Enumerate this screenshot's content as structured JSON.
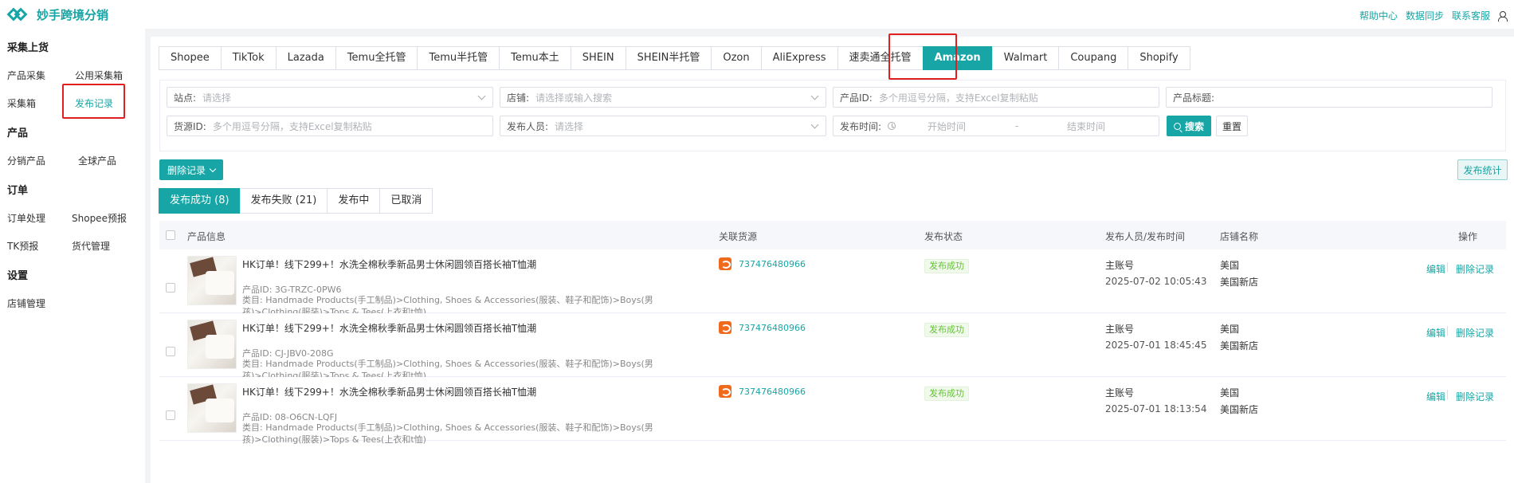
{
  "app": {
    "title": "妙手跨境分销"
  },
  "top_links": [
    "帮助中心",
    "数据同步",
    "联系客服"
  ],
  "sidebar": {
    "group1": "采集上货",
    "item_collect": "产品采集",
    "item_public_box": "公用采集箱",
    "item_collect_box": "采集箱",
    "item_publish_record": "发布记录",
    "group2": "产品",
    "item_dist_product": "分销产品",
    "item_global_product": "全球产品",
    "group3": "订单",
    "item_order_process": "订单处理",
    "item_shopee_forecast": "Shopee预报",
    "item_tk_forecast": "TK预报",
    "item_cargo_manage": "货代管理",
    "group4": "设置",
    "item_store_manage": "店铺管理"
  },
  "platform_tabs": [
    "Shopee",
    "TikTok",
    "Lazada",
    "Temu全托管",
    "Temu半托管",
    "Temu本土",
    "SHEIN",
    "SHEIN半托管",
    "Ozon",
    "AliExpress",
    "速卖通全托管",
    "Amazon",
    "Walmart",
    "Coupang",
    "Shopify"
  ],
  "active_platform": "Amazon",
  "filters": {
    "site_label": "站点:",
    "site_placeholder": "请选择",
    "store_label": "店铺:",
    "store_placeholder": "请选择或输入搜索",
    "product_id_label": "产品ID:",
    "product_id_placeholder": "多个用逗号分隔，支持Excel复制粘贴",
    "product_title_label": "产品标题:",
    "source_id_label": "货源ID:",
    "source_id_placeholder": "多个用逗号分隔，支持Excel复制粘贴",
    "publisher_label": "发布人员:",
    "publisher_placeholder": "请选择",
    "publish_time_label": "发布时间:",
    "start_time_placeholder": "开始时间",
    "time_sep": "-",
    "end_time_placeholder": "结束时间",
    "search_button": "搜索",
    "reset_button": "重置"
  },
  "toolbar": {
    "delete_records": "删除记录",
    "publish_stats": "发布统计"
  },
  "status_tabs": [
    "发布成功 (8)",
    "发布失败 (21)",
    "发布中",
    "已取消"
  ],
  "table": {
    "headers": {
      "product_info": "产品信息",
      "source": "关联货源",
      "status": "发布状态",
      "publisher_time": "发布人员/发布时间",
      "store_name": "店铺名称",
      "actions": "操作"
    },
    "rows": [
      {
        "title": "HK订单！线下299+！水洗全棉秋季新品男士休闲圆领百搭长袖T恤潮",
        "product_id": "产品ID: 3G-TRZC-0PW6",
        "category": "类目: Handmade Products(手工制品)>Clothing, Shoes & Accessories(服装、鞋子和配饰)>Boys(男孩)>Clothing(服装)>Tops & Tees(上衣和t恤)",
        "source_id": "737476480966",
        "status": "发布成功",
        "publisher": "主账号",
        "time": "2025-07-02 10:05:43",
        "region": "美国",
        "store": "美国新店",
        "edit": "编辑",
        "delete": "删除记录"
      },
      {
        "title": "HK订单！线下299+！水洗全棉秋季新品男士休闲圆领百搭长袖T恤潮",
        "product_id": "产品ID: CJ-JBV0-208G",
        "category": "类目: Handmade Products(手工制品)>Clothing, Shoes & Accessories(服装、鞋子和配饰)>Boys(男孩)>Clothing(服装)>Tops & Tees(上衣和t恤)",
        "source_id": "737476480966",
        "status": "发布成功",
        "publisher": "主账号",
        "time": "2025-07-01 18:45:45",
        "region": "美国",
        "store": "美国新店",
        "edit": "编辑",
        "delete": "删除记录"
      },
      {
        "title": "HK订单！线下299+！水洗全棉秋季新品男士休闲圆领百搭长袖T恤潮",
        "product_id": "产品ID: 08-O6CN-LQFJ",
        "category": "类目: Handmade Products(手工制品)>Clothing, Shoes & Accessories(服装、鞋子和配饰)>Boys(男孩)>Clothing(服装)>Tops & Tees(上衣和t恤)",
        "source_id": "737476480966",
        "status": "发布成功",
        "publisher": "主账号",
        "time": "2025-07-01 18:13:54",
        "region": "美国",
        "store": "美国新店",
        "edit": "编辑",
        "delete": "删除记录"
      }
    ]
  },
  "colors": {
    "accent": "#17a5a5",
    "highlight_box": "#e02020",
    "success": "#67c23a",
    "source_icon": "#f06a1e"
  }
}
